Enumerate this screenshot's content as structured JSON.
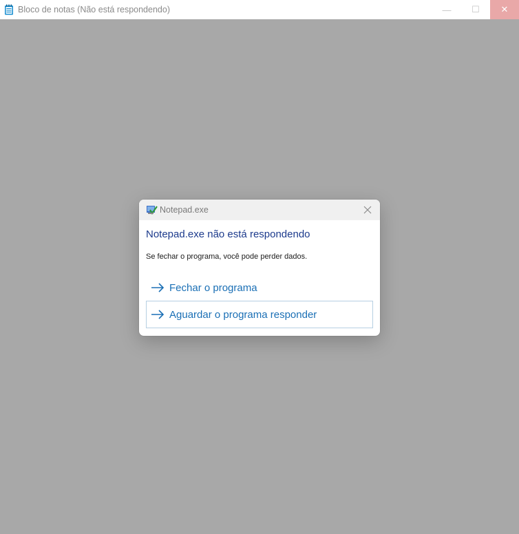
{
  "window": {
    "title": "Bloco de notas (Não está respondendo)",
    "minimize_glyph": "—",
    "maximize_glyph": "☐",
    "close_glyph": "✕",
    "app_icon": "notepad-icon"
  },
  "dialog": {
    "title": "Notepad.exe",
    "heading": "Notepad.exe não está respondendo",
    "message": "Se fechar o programa, você pode perder dados.",
    "options": [
      {
        "label": "Fechar o programa",
        "icon": "arrow-right-icon"
      },
      {
        "label": "Aguardar o programa responder",
        "icon": "arrow-right-icon"
      }
    ],
    "dialog_icon": "program-icon",
    "close_icon": "close-icon"
  },
  "colors": {
    "overlay": "#a8a8a8",
    "heading": "#1c3a8c",
    "link": "#1a6fb5",
    "close_hover": "#e9a8a8"
  }
}
